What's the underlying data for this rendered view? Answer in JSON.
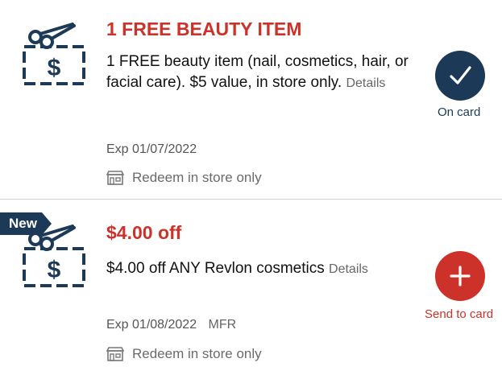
{
  "coupons": [
    {
      "title": "1 FREE BEAUTY ITEM",
      "description": "1 FREE beauty item (nail, cosmetics, hair, or facial care). $5 value, in store only.",
      "details_label": "Details",
      "expiration": "Exp 01/07/2022",
      "redeem_label": "Redeem in store only",
      "status_label": "On card",
      "status_icon": "check-icon",
      "status_color": "#1c3a57",
      "coupon_icon": "coupon-scissors-icon"
    },
    {
      "badge": "New",
      "title": "$4.00 off",
      "description": "$4.00 off ANY Revlon cosmetics",
      "details_label": "Details",
      "expiration": "Exp 01/08/2022",
      "manufacturer_tag": "MFR",
      "redeem_label": "Redeem in store only",
      "status_label": "Send to card",
      "status_icon": "plus-icon",
      "status_color": "#cc3229",
      "coupon_icon": "coupon-scissors-icon"
    }
  ],
  "colors": {
    "brand_red": "#cc3229",
    "navy": "#1c3a57",
    "divider": "#cfcfcf"
  }
}
